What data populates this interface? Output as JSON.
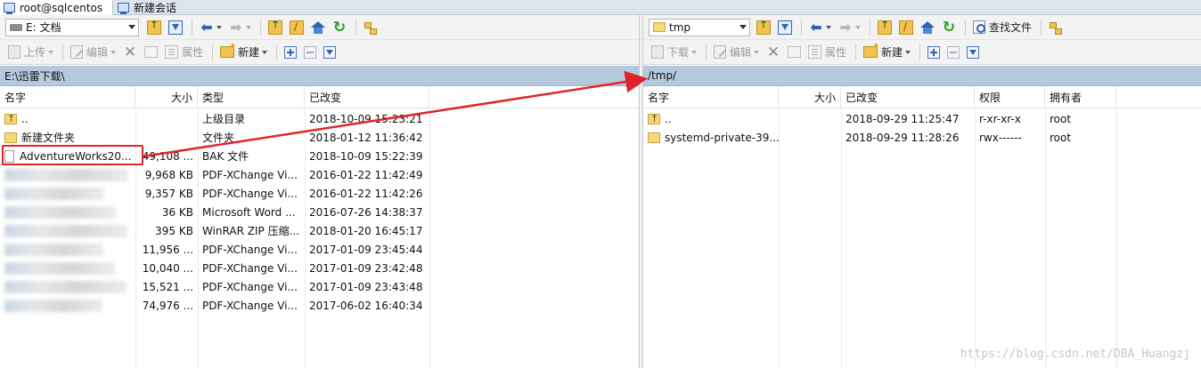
{
  "tabs": [
    {
      "label": "root@sqlcentos"
    },
    {
      "label": "新建会话"
    }
  ],
  "left": {
    "drive": "E: 文档",
    "toolbar2": {
      "upload": "上传",
      "edit": "编辑",
      "props": "属性",
      "new": "新建"
    },
    "path": "E:\\迅雷下载\\",
    "columns": {
      "name": "名字",
      "size": "大小",
      "type": "类型",
      "modified": "已改变"
    },
    "rows": [
      {
        "name": "..",
        "size": "",
        "type": "上级目录",
        "modified": "2018-10-09  15:23:21",
        "icon": "parent"
      },
      {
        "name": "新建文件夹",
        "size": "",
        "type": "文件夹",
        "modified": "2018-01-12  11:36:42",
        "icon": "folder"
      },
      {
        "name": "AdventureWorks20...",
        "size": "49,108 ...",
        "type": "BAK 文件",
        "modified": "2018-10-09  15:22:39",
        "icon": "file"
      },
      {
        "name": "",
        "size": "9,968 KB",
        "type": "PDF-XChange Vi...",
        "modified": "2016-01-22  11:42:49",
        "icon": "blur"
      },
      {
        "name": "",
        "size": "9,357 KB",
        "type": "PDF-XChange Vi...",
        "modified": "2016-01-22  11:42:26",
        "icon": "blur"
      },
      {
        "name": "",
        "size": "36 KB",
        "type": "Microsoft Word ...",
        "modified": "2016-07-26  14:38:37",
        "icon": "blur"
      },
      {
        "name": "",
        "size": "395 KB",
        "type": "WinRAR ZIP 压缩...",
        "modified": "2018-01-20  16:45:17",
        "icon": "blur"
      },
      {
        "name": "",
        "size": "11,956 ...",
        "type": "PDF-XChange Vi...",
        "modified": "2017-01-09  23:45:44",
        "icon": "blur"
      },
      {
        "name": "",
        "size": "10,040 ...",
        "type": "PDF-XChange Vi...",
        "modified": "2017-01-09  23:42:48",
        "icon": "blur"
      },
      {
        "name": "",
        "size": "15,521 ...",
        "type": "PDF-XChange Vi...",
        "modified": "2017-01-09  23:43:48",
        "icon": "blur"
      },
      {
        "name": "",
        "size": "74,976 ...",
        "type": "PDF-XChange Vi...",
        "modified": "2017-06-02  16:40:34",
        "icon": "blur"
      }
    ]
  },
  "right": {
    "drive": "tmp",
    "find_label": "查找文件",
    "toolbar2": {
      "download": "下载",
      "edit": "编辑",
      "props": "属性",
      "new": "新建"
    },
    "path": "/tmp/",
    "columns": {
      "name": "名字",
      "size": "大小",
      "modified": "已改变",
      "rights": "权限",
      "owner": "拥有者"
    },
    "rows": [
      {
        "name": "..",
        "size": "",
        "modified": "2018-09-29 11:25:47",
        "rights": "r-xr-xr-x",
        "owner": "root",
        "icon": "parent"
      },
      {
        "name": "systemd-private-39...",
        "size": "",
        "modified": "2018-09-29 11:28:26",
        "rights": "rwx------",
        "owner": "root",
        "icon": "folder"
      }
    ]
  },
  "watermark": "https://blog.csdn.net/DBA_Huangzj",
  "annotation": {
    "color": "#e0242a"
  }
}
